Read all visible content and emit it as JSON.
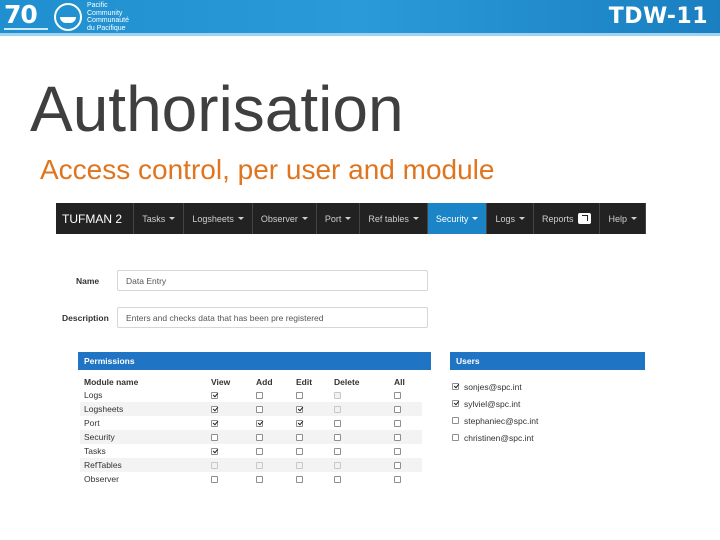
{
  "banner": {
    "logo_number": "70",
    "org_lines": [
      "Pacific",
      "Community",
      "Communauté",
      "du Pacifique"
    ],
    "event": "TDW-11"
  },
  "slide": {
    "title": "Authorisation",
    "subtitle": "Access control, per user and module"
  },
  "app": {
    "brand": "TUFMAN 2",
    "nav": [
      {
        "label": "Tasks",
        "dropdown": true
      },
      {
        "label": "Logsheets",
        "dropdown": true
      },
      {
        "label": "Observer",
        "dropdown": true
      },
      {
        "label": "Port",
        "dropdown": true
      },
      {
        "label": "Ref tables",
        "dropdown": true
      },
      {
        "label": "Security",
        "dropdown": true,
        "active": true
      },
      {
        "label": "Logs",
        "dropdown": true
      },
      {
        "label": "Reports",
        "dropdown": false,
        "icon": "external-link-icon"
      },
      {
        "label": "Help",
        "dropdown": true
      }
    ],
    "accent": "#1a84c7"
  },
  "form": {
    "name_label": "Name",
    "name_value": "Data Entry",
    "description_label": "Description",
    "description_value": "Enters and checks data that has been pre registered"
  },
  "permissions": {
    "header": "Permissions",
    "columns": [
      "Module name",
      "View",
      "Add",
      "Edit",
      "Delete",
      "All"
    ],
    "rows": [
      {
        "module": "Logs",
        "view": true,
        "add": false,
        "edit": false,
        "delete": false,
        "all": false
      },
      {
        "module": "Logsheets",
        "view": true,
        "add": false,
        "edit": true,
        "delete": false,
        "all": false
      },
      {
        "module": "Port",
        "view": true,
        "add": true,
        "edit": true,
        "delete": false,
        "all": false
      },
      {
        "module": "Security",
        "view": false,
        "add": false,
        "edit": false,
        "delete": false,
        "all": false
      },
      {
        "module": "Tasks",
        "view": true,
        "add": false,
        "edit": false,
        "delete": false,
        "all": false
      },
      {
        "module": "RefTables",
        "view": false,
        "add": false,
        "edit": false,
        "delete": false,
        "all": false
      },
      {
        "module": "Observer",
        "view": false,
        "add": false,
        "edit": false,
        "delete": false,
        "all": false
      }
    ]
  },
  "users": {
    "header": "Users",
    "list": [
      {
        "email": "sonjes@spc.int",
        "checked": true
      },
      {
        "email": "sylviel@spc.int",
        "checked": true
      },
      {
        "email": "stephaniec@spc.int",
        "checked": false
      },
      {
        "email": "christinen@spc.int",
        "checked": false
      }
    ]
  }
}
